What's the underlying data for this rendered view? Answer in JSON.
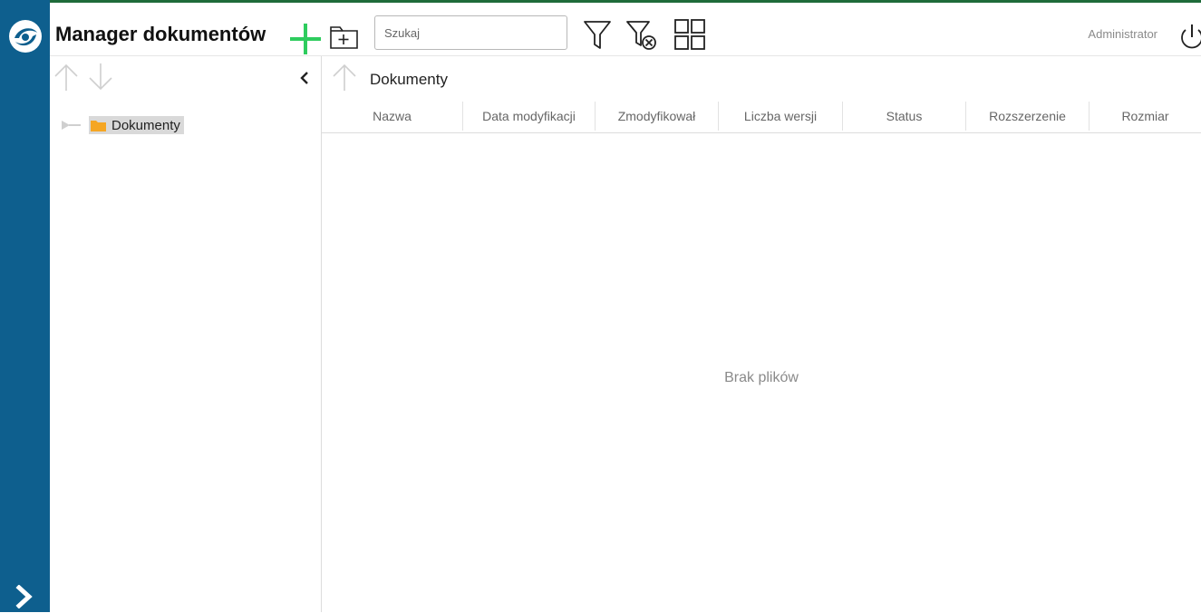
{
  "app": {
    "title": "Manager dokumentów",
    "user": "Administrator",
    "accent_color": "#0e5f8e",
    "add_color": "#2ecc5e"
  },
  "search": {
    "placeholder": "Szukaj",
    "value": ""
  },
  "icons": {
    "logo": "app-logo-icon",
    "add": "plus-icon",
    "new_folder": "new-folder-icon",
    "filter": "filter-icon",
    "filter_clear": "filter-clear-icon",
    "view": "grid-view-icon",
    "power": "power-icon",
    "expand": "chevron-right-icon"
  },
  "tree": {
    "items": [
      {
        "label": "Dokumenty",
        "selected": true
      }
    ]
  },
  "main": {
    "path_title": "Dokumenty",
    "columns": [
      "Nazwa",
      "Data modyfikacji",
      "Zmodyfikował",
      "Liczba wersji",
      "Status",
      "Rozszerzenie",
      "Rozmiar"
    ],
    "empty_message": "Brak plików"
  }
}
